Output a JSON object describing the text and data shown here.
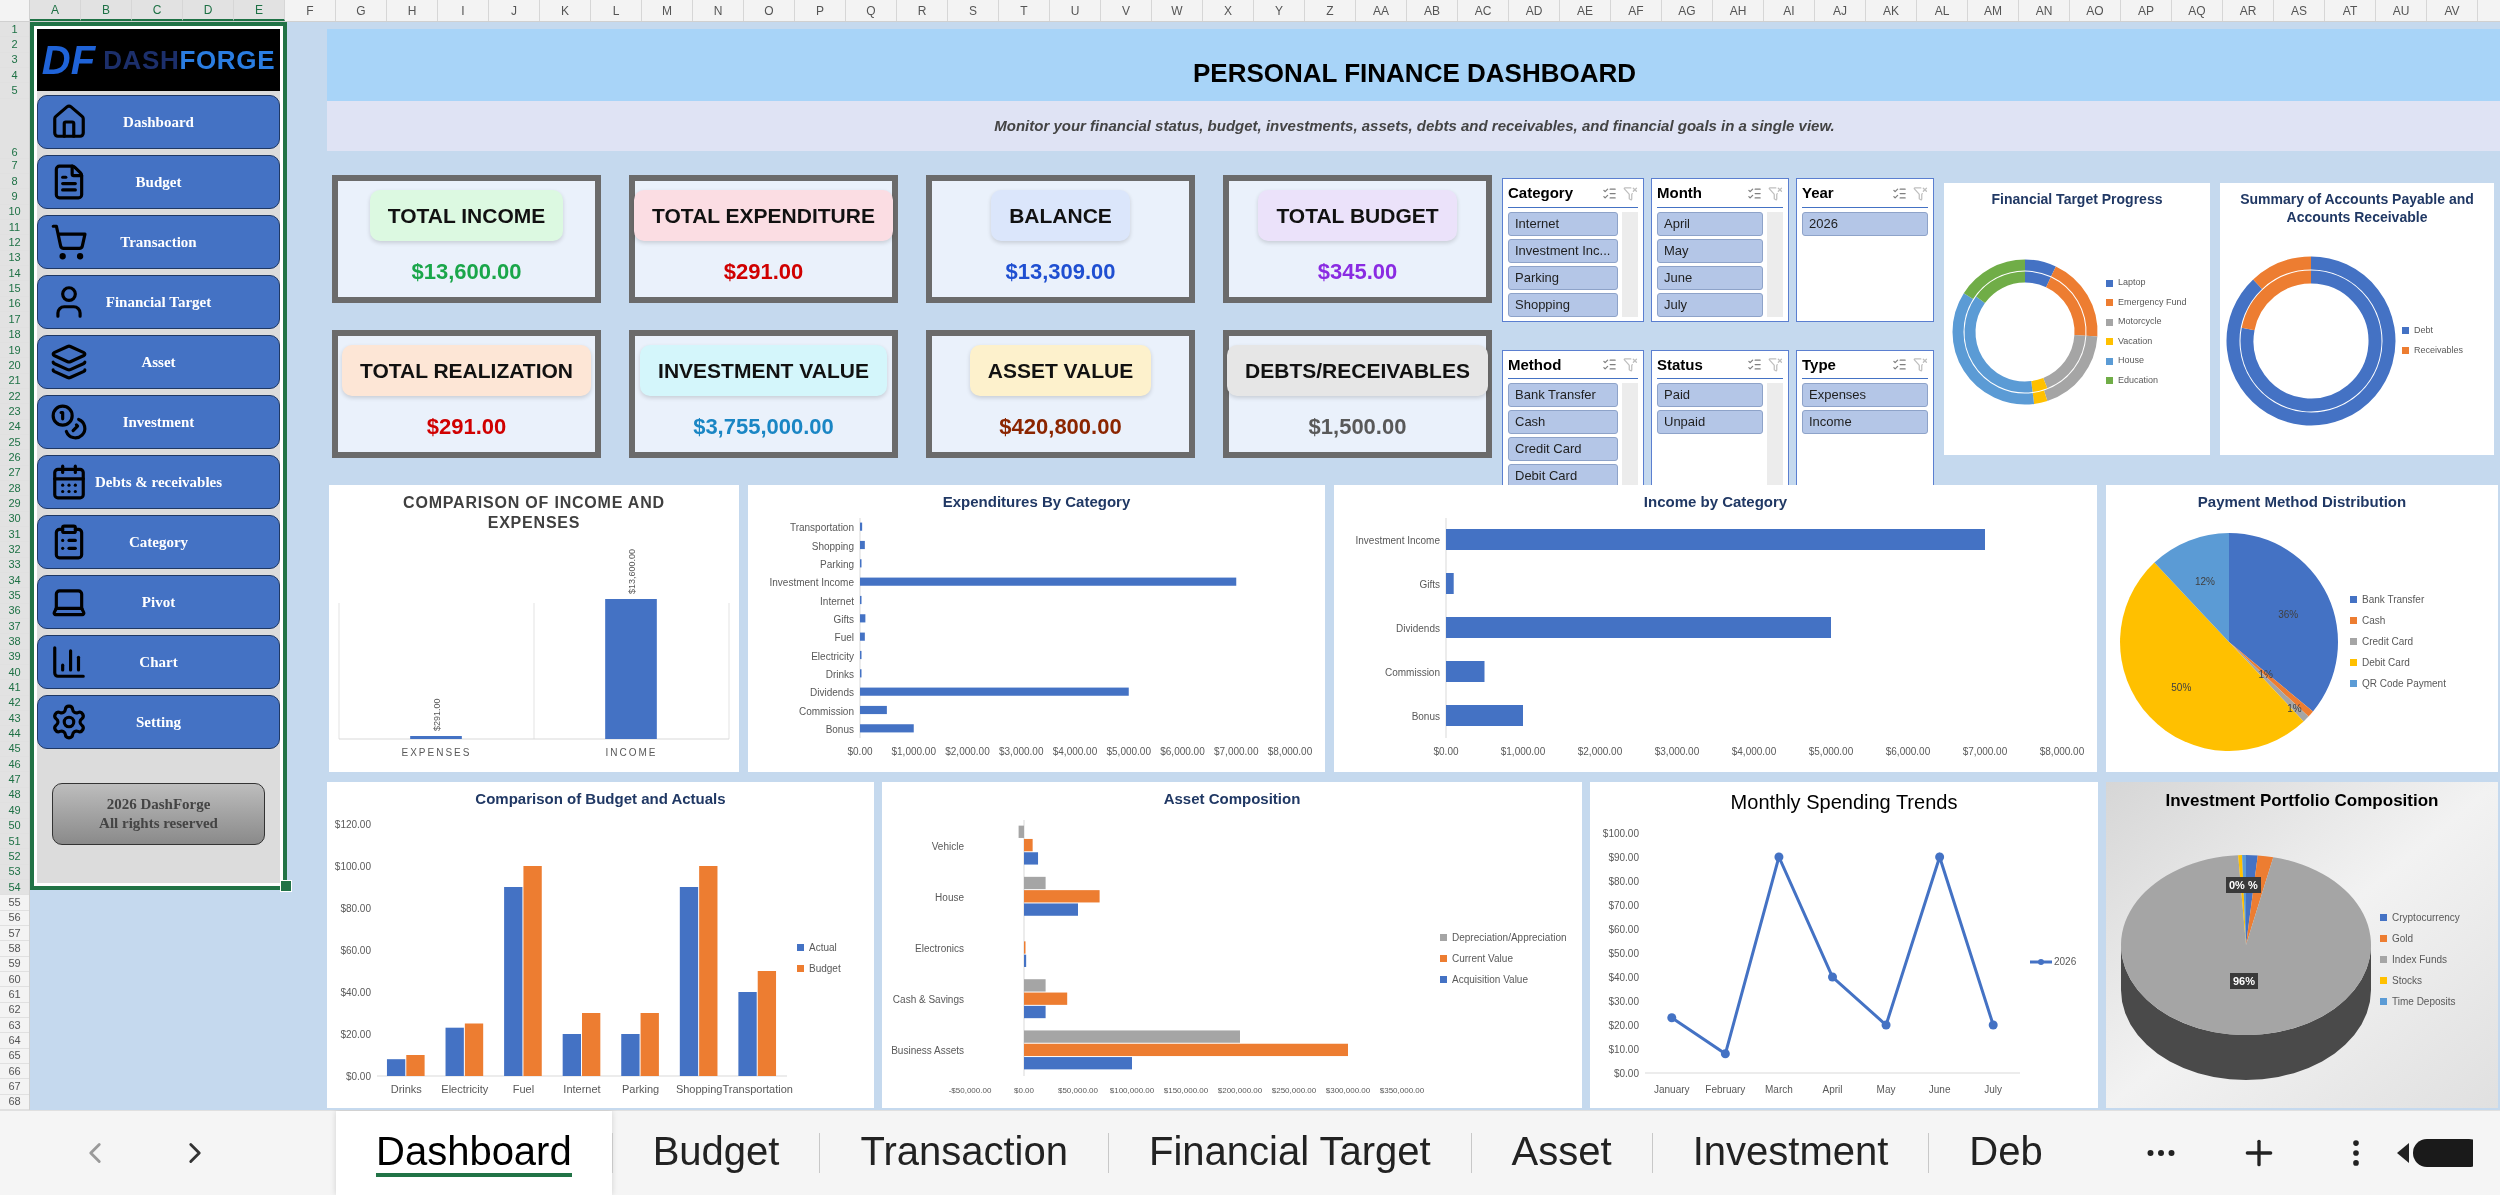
{
  "columns": [
    {
      "label": "A",
      "selected": true
    },
    {
      "label": "B",
      "selected": true
    },
    {
      "label": "C",
      "selected": true
    },
    {
      "label": "D",
      "selected": true
    },
    {
      "label": "E",
      "selected": true
    },
    {
      "label": "F",
      "selected": false
    },
    {
      "label": "G",
      "selected": false
    },
    {
      "label": "H",
      "selected": false
    },
    {
      "label": "I",
      "selected": false
    },
    {
      "label": "J",
      "selected": false
    },
    {
      "label": "K",
      "selected": false
    },
    {
      "label": "L",
      "selected": false
    },
    {
      "label": "M",
      "selected": false
    },
    {
      "label": "N",
      "selected": false
    },
    {
      "label": "O",
      "selected": false
    },
    {
      "label": "P",
      "selected": false
    },
    {
      "label": "Q",
      "selected": false
    },
    {
      "label": "R",
      "selected": false
    },
    {
      "label": "S",
      "selected": false
    },
    {
      "label": "T",
      "selected": false
    },
    {
      "label": "U",
      "selected": false
    },
    {
      "label": "V",
      "selected": false
    },
    {
      "label": "W",
      "selected": false
    },
    {
      "label": "X",
      "selected": false
    },
    {
      "label": "Y",
      "selected": false
    },
    {
      "label": "Z",
      "selected": false
    },
    {
      "label": "AA",
      "selected": false
    },
    {
      "label": "AB",
      "selected": false
    },
    {
      "label": "AC",
      "selected": false
    },
    {
      "label": "AD",
      "selected": false
    },
    {
      "label": "AE",
      "selected": false
    },
    {
      "label": "AF",
      "selected": false
    },
    {
      "label": "AG",
      "selected": false
    },
    {
      "label": "AH",
      "selected": false
    },
    {
      "label": "AI",
      "selected": false
    },
    {
      "label": "AJ",
      "selected": false
    },
    {
      "label": "AK",
      "selected": false
    },
    {
      "label": "AL",
      "selected": false
    },
    {
      "label": "AM",
      "selected": false
    },
    {
      "label": "AN",
      "selected": false
    },
    {
      "label": "AO",
      "selected": false
    },
    {
      "label": "AP",
      "selected": false
    },
    {
      "label": "AQ",
      "selected": false
    },
    {
      "label": "AR",
      "selected": false
    },
    {
      "label": "AS",
      "selected": false
    },
    {
      "label": "AT",
      "selected": false
    },
    {
      "label": "AU",
      "selected": false
    },
    {
      "label": "AV",
      "selected": false
    }
  ],
  "rows": [
    {
      "label": "1",
      "selected": true
    },
    {
      "label": "2",
      "selected": true
    },
    {
      "label": "3",
      "selected": true
    },
    {
      "label": "4",
      "selected": true
    },
    {
      "label": "5",
      "selected": true
    },
    {
      "label": "6",
      "selected": true
    },
    {
      "label": "7",
      "selected": true
    },
    {
      "label": "8",
      "selected": true
    },
    {
      "label": "9",
      "selected": true
    },
    {
      "label": "10",
      "selected": true
    },
    {
      "label": "11",
      "selected": true
    },
    {
      "label": "12",
      "selected": true
    },
    {
      "label": "13",
      "selected": true
    },
    {
      "label": "14",
      "selected": true
    },
    {
      "label": "15",
      "selected": true
    },
    {
      "label": "16",
      "selected": true
    },
    {
      "label": "17",
      "selected": true
    },
    {
      "label": "18",
      "selected": true
    },
    {
      "label": "19",
      "selected": true
    },
    {
      "label": "20",
      "selected": true
    },
    {
      "label": "21",
      "selected": true
    },
    {
      "label": "22",
      "selected": true
    },
    {
      "label": "23",
      "selected": true
    },
    {
      "label": "24",
      "selected": true
    },
    {
      "label": "25",
      "selected": true
    },
    {
      "label": "26",
      "selected": true
    },
    {
      "label": "27",
      "selected": true
    },
    {
      "label": "28",
      "selected": true
    },
    {
      "label": "29",
      "selected": true
    },
    {
      "label": "30",
      "selected": true
    },
    {
      "label": "31",
      "selected": true
    },
    {
      "label": "32",
      "selected": true
    },
    {
      "label": "33",
      "selected": true
    },
    {
      "label": "34",
      "selected": true
    },
    {
      "label": "35",
      "selected": true
    },
    {
      "label": "36",
      "selected": true
    },
    {
      "label": "37",
      "selected": true
    },
    {
      "label": "38",
      "selected": true
    },
    {
      "label": "39",
      "selected": true
    },
    {
      "label": "40",
      "selected": true
    },
    {
      "label": "41",
      "selected": true
    },
    {
      "label": "42",
      "selected": true
    },
    {
      "label": "43",
      "selected": true
    },
    {
      "label": "44",
      "selected": true
    },
    {
      "label": "45",
      "selected": true
    },
    {
      "label": "46",
      "selected": true
    },
    {
      "label": "47",
      "selected": true
    },
    {
      "label": "48",
      "selected": true
    },
    {
      "label": "49",
      "selected": true
    },
    {
      "label": "50",
      "selected": true
    },
    {
      "label": "51",
      "selected": true
    },
    {
      "label": "52",
      "selected": true
    },
    {
      "label": "53",
      "selected": true
    },
    {
      "label": "54",
      "selected": true
    },
    {
      "label": "55",
      "selected": false
    },
    {
      "label": "56",
      "selected": false
    },
    {
      "label": "57",
      "selected": false
    },
    {
      "label": "58",
      "selected": false
    },
    {
      "label": "59",
      "selected": false
    },
    {
      "label": "60",
      "selected": false
    },
    {
      "label": "61",
      "selected": false
    },
    {
      "label": "62",
      "selected": false
    },
    {
      "label": "63",
      "selected": false
    },
    {
      "label": "64",
      "selected": false
    },
    {
      "label": "65",
      "selected": false
    },
    {
      "label": "66",
      "selected": false
    },
    {
      "label": "67",
      "selected": false
    },
    {
      "label": "68",
      "selected": false
    }
  ],
  "sidebar": {
    "logo": {
      "mark": "DF",
      "text_1": "DASH",
      "text_2": "FORGE"
    },
    "items": [
      {
        "label": "Dashboard"
      },
      {
        "label": "Budget"
      },
      {
        "label": "Transaction"
      },
      {
        "label": "Financial Target"
      },
      {
        "label": "Asset"
      },
      {
        "label": "Investment"
      },
      {
        "label": "Debts & receivables"
      },
      {
        "label": "Category"
      },
      {
        "label": "Pivot"
      },
      {
        "label": "Chart"
      },
      {
        "label": "Setting"
      }
    ],
    "footer": [
      "2026 DashForge",
      "All rights reserved"
    ]
  },
  "header": {
    "title": "PERSONAL FINANCE DASHBOARD",
    "subtitle": "Monitor your financial status, budget, investments, assets, debts and receivables, and financial goals in a single view."
  },
  "kpis": [
    {
      "label": "TOTAL INCOME",
      "value": "$13,600.00",
      "color": "#1aa64a"
    },
    {
      "label": "TOTAL EXPENDITURE",
      "value": "$291.00",
      "color": "#d00000"
    },
    {
      "label": "BALANCE",
      "value": "$13,309.00",
      "color": "#1f4fd1"
    },
    {
      "label": "TOTAL BUDGET",
      "value": "$345.00",
      "color": "#8a2be2"
    },
    {
      "label": "TOTAL REALIZATION",
      "value": "$291.00",
      "color": "#d00000"
    },
    {
      "label": "INVESTMENT VALUE",
      "value": "$3,755,000.00",
      "color": "#1a86c4"
    },
    {
      "label": "ASSET VALUE",
      "value": "$420,800.00",
      "color": "#8b2500"
    },
    {
      "label": "DEBTS/RECEIVABLES",
      "value": "$1,500.00",
      "color": "#595959"
    }
  ],
  "slicers": [
    {
      "title": "Category",
      "scrollbar": true,
      "items": [
        {
          "label": "Internet",
          "selected": true
        },
        {
          "label": "Investment Inc...",
          "selected": true
        },
        {
          "label": "Parking",
          "selected": true
        },
        {
          "label": "Shopping",
          "selected": true
        }
      ]
    },
    {
      "title": "Month",
      "scrollbar": true,
      "items": [
        {
          "label": "April",
          "selected": true
        },
        {
          "label": "May",
          "selected": true
        },
        {
          "label": "June",
          "selected": true
        },
        {
          "label": "July",
          "selected": true
        }
      ]
    },
    {
      "title": "Year",
      "scrollbar": false,
      "items": [
        {
          "label": "2026",
          "selected": true
        }
      ]
    },
    {
      "title": "Method",
      "scrollbar": true,
      "items": [
        {
          "label": "Bank Transfer",
          "selected": true
        },
        {
          "label": "Cash",
          "selected": true
        },
        {
          "label": "Credit Card",
          "selected": true
        },
        {
          "label": "Debit Card",
          "selected": true
        }
      ]
    },
    {
      "title": "Status",
      "scrollbar": true,
      "items": [
        {
          "label": "Paid",
          "selected": true
        },
        {
          "label": "Unpaid",
          "selected": true
        }
      ]
    },
    {
      "title": "Type",
      "scrollbar": false,
      "items": [
        {
          "label": "Expenses",
          "selected": true
        },
        {
          "label": "Income",
          "selected": true
        }
      ]
    }
  ],
  "financial_target": {
    "title": "Financial Target Progress",
    "legend": [
      "Laptop",
      "Emergency Fund",
      "Motorcycle",
      "Vacation",
      "House",
      "Education"
    ]
  },
  "accounts_summary": {
    "title": "Summary of Accounts Payable and Accounts Receivable",
    "legend": [
      "Debt",
      "Receivables"
    ]
  },
  "income_vs_expenses": {
    "chart_data": {
      "type": "bar",
      "title": "COMPARISON OF INCOME AND EXPENSES",
      "categories": [
        "EXPENSES",
        "INCOME"
      ],
      "values": [
        291,
        13600
      ],
      "data_labels": true,
      "value_labels": [
        "$291.00",
        "$13,600.00"
      ]
    }
  },
  "expenditures": {
    "chart_data": {
      "type": "bar",
      "orientation": "horizontal",
      "title": "Expenditures By Category",
      "categories": [
        "Transportation",
        "Shopping",
        "Parking",
        "Investment Income",
        "Internet",
        "Gifts",
        "Fuel",
        "Electricity",
        "Drinks",
        "Dividends",
        "Commission",
        "Bonus"
      ],
      "values": [
        40,
        90,
        20,
        7000,
        20,
        100,
        90,
        23,
        8,
        5000,
        500,
        1000
      ],
      "xlim": [
        0,
        8000
      ],
      "xticks": [
        {
          "value": 0,
          "label": "$0.00"
        },
        {
          "value": 1000,
          "label": "$1,000.00"
        },
        {
          "value": 2000,
          "label": "$2,000.00"
        },
        {
          "value": 3000,
          "label": "$3,000.00"
        },
        {
          "value": 4000,
          "label": "$4,000.00"
        },
        {
          "value": 5000,
          "label": "$5,000.00"
        },
        {
          "value": 6000,
          "label": "$6,000.00"
        },
        {
          "value": 7000,
          "label": "$7,000.00"
        },
        {
          "value": 8000,
          "label": "$8,000.00"
        }
      ]
    }
  },
  "income": {
    "chart_data": {
      "type": "bar",
      "orientation": "horizontal",
      "title": "Income by Category",
      "categories": [
        "Investment Income",
        "Gifts",
        "Dividends",
        "Commission",
        "Bonus"
      ],
      "values": [
        7000,
        100,
        5000,
        500,
        1000
      ],
      "xlim": [
        0,
        8000
      ],
      "xticks": [
        {
          "value": 0,
          "label": "$0.00"
        },
        {
          "value": 1000,
          "label": "$1,000.00"
        },
        {
          "value": 2000,
          "label": "$2,000.00"
        },
        {
          "value": 3000,
          "label": "$3,000.00"
        },
        {
          "value": 4000,
          "label": "$4,000.00"
        },
        {
          "value": 5000,
          "label": "$5,000.00"
        },
        {
          "value": 6000,
          "label": "$6,000.00"
        },
        {
          "value": 7000,
          "label": "$7,000.00"
        },
        {
          "value": 8000,
          "label": "$8,000.00"
        }
      ]
    }
  },
  "payment_methods": {
    "chart_data": {
      "type": "pie",
      "title": "Payment Method Distribution",
      "categories": [
        "Bank Transfer",
        "Cash",
        "Credit Card",
        "Debit Card",
        "QR Code Payment"
      ],
      "values": [
        36,
        1,
        1,
        50,
        12
      ],
      "data_labels": true,
      "value_labels": [
        "36%",
        "1%",
        "1%",
        "50%",
        "12%"
      ]
    }
  },
  "budget_vs_actual": {
    "chart_data": {
      "type": "bar",
      "title": "Comparison of Budget and Actuals",
      "categories": [
        "Drinks",
        "Electricity",
        "Fuel",
        "Internet",
        "Parking",
        "Shopping",
        "Transportation"
      ],
      "series": [
        {
          "name": "Actual",
          "color": "#4472c4",
          "values": [
            8,
            23,
            90,
            20,
            20,
            90,
            40
          ]
        },
        {
          "name": "Budget",
          "color": "#ed7d31",
          "values": [
            10,
            25,
            100,
            30,
            30,
            100,
            50
          ]
        }
      ],
      "ylim": [
        0,
        120
      ],
      "yticks": [
        {
          "value": 0,
          "label": "$0.00"
        },
        {
          "value": 20,
          "label": "$20.00"
        },
        {
          "value": 40,
          "label": "$40.00"
        },
        {
          "value": 60,
          "label": "$60.00"
        },
        {
          "value": 80,
          "label": "$80.00"
        },
        {
          "value": 100,
          "label": "$100.00"
        },
        {
          "value": 120,
          "label": "$120.00"
        }
      ]
    }
  },
  "assets": {
    "chart_data": {
      "type": "bar",
      "orientation": "horizontal",
      "title": "Asset Composition",
      "categories": [
        "Vehicle",
        "House",
        "Electronics",
        "Cash & Savings",
        "Business Assets"
      ],
      "series": [
        {
          "name": "Depreciation/Appreciation",
          "color": "#a5a5a5",
          "values": [
            -5000,
            20000,
            null,
            20000,
            200000
          ]
        },
        {
          "name": "Current Value",
          "color": "#ed7d31",
          "values": [
            8000,
            70000,
            1000,
            40000,
            300000
          ]
        },
        {
          "name": "Acquisition Value",
          "color": "#4472c4",
          "values": [
            13000,
            50000,
            2000,
            20000,
            100000
          ]
        }
      ],
      "xlim": [
        -50000,
        350000
      ],
      "xticks": [
        {
          "value": -50000,
          "label": "-$50,000.00"
        },
        {
          "value": 0,
          "label": "$0.00"
        },
        {
          "value": 50000,
          "label": "$50,000.00"
        },
        {
          "value": 100000,
          "label": "$100,000.00"
        },
        {
          "value": 150000,
          "label": "$150,000.00"
        },
        {
          "value": 200000,
          "label": "$200,000.00"
        },
        {
          "value": 250000,
          "label": "$250,000.00"
        },
        {
          "value": 300000,
          "label": "$300,000.00"
        },
        {
          "value": 350000,
          "label": "$350,000.00"
        }
      ]
    }
  },
  "monthly_spending": {
    "chart_data": {
      "type": "line",
      "title": "Monthly Spending Trends",
      "categories": [
        "January",
        "February",
        "March",
        "April",
        "May",
        "June",
        "July"
      ],
      "series": [
        {
          "name": "2026",
          "color": "#4472c4",
          "marker": "o",
          "values": [
            23,
            8,
            90,
            40,
            20,
            90,
            20
          ]
        }
      ],
      "ylim": [
        0,
        100
      ],
      "yticks": [
        {
          "value": 0,
          "label": "$0.00"
        },
        {
          "value": 10,
          "label": "$10.00"
        },
        {
          "value": 20,
          "label": "$20.00"
        },
        {
          "value": 30,
          "label": "$30.00"
        },
        {
          "value": 40,
          "label": "$40.00"
        },
        {
          "value": 50,
          "label": "$50.00"
        },
        {
          "value": 60,
          "label": "$60.00"
        },
        {
          "value": 70,
          "label": "$70.00"
        },
        {
          "value": 80,
          "label": "$80.00"
        },
        {
          "value": 90,
          "label": "$90.00"
        },
        {
          "value": 100,
          "label": "$100.00"
        }
      ]
    }
  },
  "investment_portfolio": {
    "title": "Investment Portfolio Composition",
    "labels": [
      "0% %",
      "96%"
    ],
    "legend": [
      "Cryptocurrency",
      "Gold",
      "Index Funds",
      "Stocks",
      "Time Deposits"
    ]
  },
  "sheet_tabs": [
    {
      "label": "Dashboard",
      "selected": true
    },
    {
      "label": "Budget",
      "selected": false
    },
    {
      "label": "Transaction",
      "selected": false
    },
    {
      "label": "Financial Target",
      "selected": false
    },
    {
      "label": "Asset",
      "selected": false
    },
    {
      "label": "Investment",
      "selected": false
    },
    {
      "label": "Deb",
      "selected": false
    }
  ]
}
